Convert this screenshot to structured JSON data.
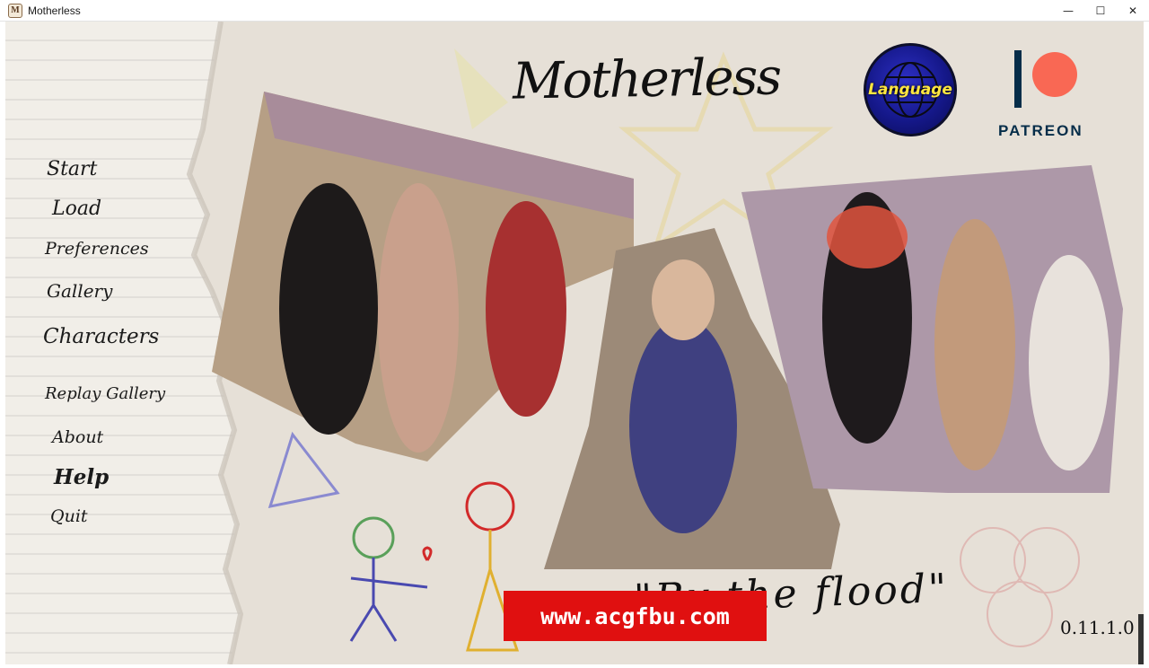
{
  "window": {
    "title": "Motherless",
    "app_icon": "M",
    "controls": {
      "minimize": "—",
      "maximize": "☐",
      "close": "✕"
    }
  },
  "game": {
    "title": "Motherless",
    "subtitle": "\"By the flood\"",
    "version": "0.11.1.0",
    "language_button": "Language",
    "patreon_label": "PATREON",
    "watermark": "www.acgfbu.com"
  },
  "menu": {
    "items": [
      {
        "label": "Start"
      },
      {
        "label": "Load"
      },
      {
        "label": "Preferences"
      },
      {
        "label": "Gallery"
      },
      {
        "label": "Characters"
      },
      {
        "label": "Replay Gallery"
      },
      {
        "label": "About"
      },
      {
        "label": "Help"
      },
      {
        "label": "Quit"
      }
    ]
  },
  "colors": {
    "paper": "#ece6dc",
    "patreon_coral": "#f96854",
    "patreon_navy": "#052d49",
    "watermark_red": "#e01010",
    "language_yellow": "#ffe640"
  }
}
